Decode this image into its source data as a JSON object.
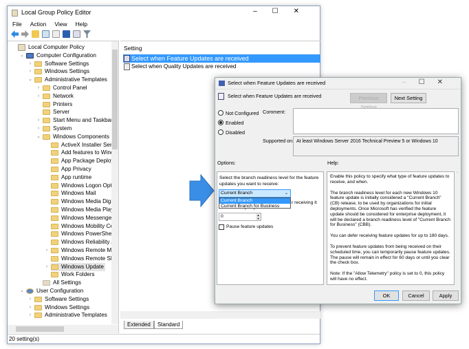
{
  "main_window": {
    "title": "Local Group Policy Editor",
    "menu": [
      "File",
      "Action",
      "View",
      "Help"
    ],
    "tree": [
      {
        "label": "Local Computer Policy",
        "level": 0,
        "chev": "",
        "icon": "policy"
      },
      {
        "label": "Computer Configuration",
        "level": 1,
        "chev": "v",
        "icon": "computer"
      },
      {
        "label": "Software Settings",
        "level": 2,
        "chev": ">",
        "icon": "folder"
      },
      {
        "label": "Windows Settings",
        "level": 2,
        "chev": ">",
        "icon": "folder"
      },
      {
        "label": "Administrative Templates",
        "level": 2,
        "chev": "v",
        "icon": "folder"
      },
      {
        "label": "Control Panel",
        "level": 3,
        "chev": ">",
        "icon": "folder"
      },
      {
        "label": "Network",
        "level": 3,
        "chev": ">",
        "icon": "folder"
      },
      {
        "label": "Printers",
        "level": 3,
        "chev": "",
        "icon": "folder"
      },
      {
        "label": "Server",
        "level": 3,
        "chev": "",
        "icon": "folder"
      },
      {
        "label": "Start Menu and Taskbar",
        "level": 3,
        "chev": ">",
        "icon": "folder"
      },
      {
        "label": "System",
        "level": 3,
        "chev": ">",
        "icon": "folder"
      },
      {
        "label": "Windows Components",
        "level": 3,
        "chev": "v",
        "icon": "folder"
      },
      {
        "label": "ActiveX Installer Service",
        "level": 4,
        "chev": "",
        "icon": "folder"
      },
      {
        "label": "Add features to Window",
        "level": 4,
        "chev": "",
        "icon": "folder"
      },
      {
        "label": "App Package Deployme",
        "level": 4,
        "chev": "",
        "icon": "folder"
      },
      {
        "label": "App Privacy",
        "level": 4,
        "chev": "",
        "icon": "folder"
      },
      {
        "label": "App runtime",
        "level": 4,
        "chev": "",
        "icon": "folder"
      },
      {
        "label": "Windows Logon Optior",
        "level": 4,
        "chev": "",
        "icon": "folder"
      },
      {
        "label": "Windows Mail",
        "level": 4,
        "chev": "",
        "icon": "folder"
      },
      {
        "label": "Windows Media Digital",
        "level": 4,
        "chev": "",
        "icon": "folder"
      },
      {
        "label": "Windows Media Player",
        "level": 4,
        "chev": "",
        "icon": "folder"
      },
      {
        "label": "Windows Messenger",
        "level": 4,
        "chev": "",
        "icon": "folder"
      },
      {
        "label": "Windows Mobility Cent",
        "level": 4,
        "chev": "",
        "icon": "folder"
      },
      {
        "label": "Windows PowerShell",
        "level": 4,
        "chev": "",
        "icon": "folder"
      },
      {
        "label": "Windows Reliability Ana",
        "level": 4,
        "chev": "",
        "icon": "folder"
      },
      {
        "label": "Windows Remote Mana",
        "level": 4,
        "chev": ">",
        "icon": "folder"
      },
      {
        "label": "Windows Remote Shell",
        "level": 4,
        "chev": "",
        "icon": "folder"
      },
      {
        "label": "Windows Update",
        "level": 4,
        "chev": ">",
        "icon": "folder",
        "selected": true
      },
      {
        "label": "Work Folders",
        "level": 4,
        "chev": "",
        "icon": "folder"
      },
      {
        "label": "All Settings",
        "level": 3,
        "chev": "",
        "icon": "allsettings"
      },
      {
        "label": "User Configuration",
        "level": 1,
        "chev": "v",
        "icon": "user"
      },
      {
        "label": "Software Settings",
        "level": 2,
        "chev": ">",
        "icon": "folder"
      },
      {
        "label": "Windows Settings",
        "level": 2,
        "chev": ">",
        "icon": "folder"
      },
      {
        "label": "Administrative Templates",
        "level": 2,
        "chev": ">",
        "icon": "folder"
      }
    ],
    "column_header": "Setting",
    "settings": [
      "Select when Feature Updates are received",
      "Select when Quality Updates are received"
    ],
    "tabs": [
      "Extended",
      "Standard"
    ],
    "status": "20 setting(s)"
  },
  "dialog": {
    "title": "Select when Feature Updates are received",
    "heading": "Select when Feature Updates are received",
    "prev_button": "Previous Setting",
    "next_button": "Next Setting",
    "radios": [
      "Not Configured",
      "Enabled",
      "Disabled"
    ],
    "selected_radio": "Enabled",
    "comment_label": "Comment:",
    "supported_label": "Supported on:",
    "supported_value": "At least Windows Server 2016 Technical Preview 5 or Windows 10",
    "options_label": "Options:",
    "help_label": "Help:",
    "options": {
      "branch_prompt": "Select the branch readiness level for the feature updates you want to receive:",
      "branch_selected": "Current Branch",
      "branch_options": [
        "Current Branch",
        "Current Branch for Business"
      ],
      "defer_label_visible": "r receiving it",
      "defer_label_line2": "for this many days:",
      "defer_value": "0",
      "pause_label": "Pause feature updates",
      "pause_checked": false
    },
    "help": [
      "Enable this policy to specify what type of feature updates to receive, and when.",
      "The branch readiness level for each new Windows 10 feature update is initially considered a \"Current Branch\" (CB) release, to be used by organizations for initial deployments. Once Microsoft has verified the feature update should be considered for enterprise deployment, it will be declared a branch readiness level of \"Current Branch for Business\" (CBB).",
      "You can defer receiving feature updates for up to 180 days.",
      "To prevent feature updates from being received on their scheduled time, you can temporarily pause feature updates. The pause will remain in effect for 60 days or until you clear the check box.",
      "Note: If the \"Allow Telemetry\" policy is set to 0, this policy will have no effect."
    ],
    "ok": "OK",
    "cancel": "Cancel",
    "apply": "Apply"
  },
  "colors": {
    "accent": "#3399ff",
    "selection": "#cce8ff",
    "arrow": "#3a8ee6"
  }
}
